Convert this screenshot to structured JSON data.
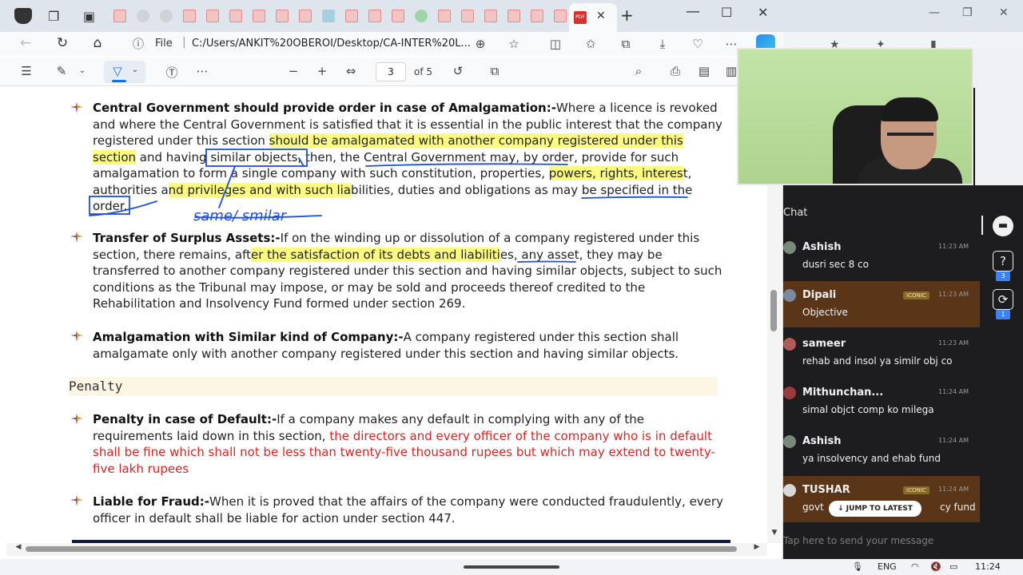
{
  "browser": {
    "url_info_icon": "info-icon",
    "file_label": "File",
    "url": "C:/Users/ANKIT%20OBEROI/Desktop/CA-INTER%20L...",
    "active_tab_badge": "PDF",
    "new_tab_label": "+",
    "close_tab_label": "✕"
  },
  "pdf_toolbar": {
    "page_current": "3",
    "page_total_label": "of 5"
  },
  "document": {
    "paragraphs": [
      {
        "heading": "Central Government should provide order in case of Amalgamation:-",
        "t1": "Where a licence is revoked and where the Central Government is satisfied that it is essential in the public interest that the company registered under this section ",
        "h1": "should be amalgamated with another company registered under this section",
        "t2": " and having similar objects, then, the Central Government may, by order, provide for such amalgamation to form a single company with such constitution, properties, ",
        "h2": "powers, rights, interes",
        "t3": "t, authorities a",
        "h3": "nd privileges and with such lia",
        "t4": "bilities, duties and obligations as may be specified in the order."
      },
      {
        "heading": "Transfer of Surplus Assets:-",
        "t1": "If on the winding up or dissolution of a company registered under this section, there remains, aft",
        "h1": "er the satisfaction of its debts and liabiliti",
        "t2": "es, any asset, they may be transferred to another company registered under this section and having similar objects, subject to such conditions as the Tribunal may impose, or may be sold and proceeds thereof credited to the Rehabilitation and Insolvency Fund formed under section 269."
      },
      {
        "heading": "Amalgamation with Similar kind of Company:-",
        "t1": "A company registered under this section shall amalgamate only with another company registered under this section and having similar objects."
      },
      {
        "heading": "Penalty in case of Default:-",
        "t1": "If a company makes any default in complying with any of the requirements laid down in this section, ",
        "red": "the directors and every officer of the company who is in default shall be fine which shall not be less than twenty-five thousand rupees but which may extend to twenty-five lakh rupees"
      },
      {
        "heading": "Liable for Fraud:-",
        "t1": "When it is proved that the affairs of the company were conducted fraudulently, every officer in default shall be liable for action under section 447."
      }
    ],
    "section_label": "Penalty",
    "ink_note": "same/ smilar"
  },
  "chat": {
    "title": "Chat",
    "messages": [
      {
        "name": "Ashish",
        "text": "dusri sec 8 co",
        "time": "11:23 AM",
        "badge": "",
        "avatar": "#7a8a7a"
      },
      {
        "name": "Dipali",
        "text": "Objective",
        "time": "11:23 AM",
        "badge": "ICONIC",
        "avatar": "#7a8aa0"
      },
      {
        "name": "sameer",
        "text": "rehab and insol ya similr obj co",
        "time": "11:23 AM",
        "badge": "",
        "avatar": "#b05a5a"
      },
      {
        "name": "Mithunchan...",
        "text": "simal objct comp ko milega",
        "time": "11:24 AM",
        "badge": "",
        "avatar": "#9a3a3a"
      },
      {
        "name": "Ashish",
        "text": "ya insolvency and ehab fund",
        "time": "11:24 AM",
        "badge": "",
        "avatar": "#7a8a7a"
      },
      {
        "name": "TUSHAR",
        "text": "govt",
        "text_tail": "cy fund",
        "time": "11:24 AM",
        "badge": "ICONIC",
        "avatar": "#d8d8d8"
      }
    ],
    "jump_label": "↓ JUMP TO LATEST",
    "input_placeholder": "Tap here to send your message",
    "side_badges": [
      "3",
      "1"
    ]
  },
  "taskbar": {
    "language": "ENG",
    "clock": "11:24"
  },
  "colors": {
    "highlight": "#fbfb7f",
    "ink_blue": "#1f4fd6",
    "red_text": "#e02020",
    "chat_bg": "#1d1d1f",
    "chat_alt": "#5a3518"
  }
}
